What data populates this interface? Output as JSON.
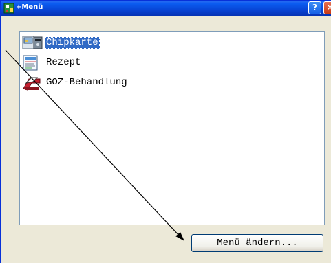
{
  "window": {
    "title": "+Menü",
    "help_label": "?",
    "close_label": "✕",
    "icon": "app-icon"
  },
  "list": {
    "items": [
      {
        "label": "Chipkarte",
        "icon": "chipcard-reader-icon",
        "selected": true
      },
      {
        "label": "Rezept",
        "icon": "prescription-form-icon",
        "selected": false
      },
      {
        "label": "GOZ-Behandlung",
        "icon": "dental-treatment-icon",
        "selected": false
      }
    ]
  },
  "actions": {
    "change_menu_label": "Menü ändern..."
  },
  "annotation": {
    "type": "arrow-pointer",
    "color": "#000000"
  },
  "colors": {
    "titlebar": "#0845d6",
    "selection": "#316ac5",
    "dialog_bg": "#ece9d8"
  }
}
